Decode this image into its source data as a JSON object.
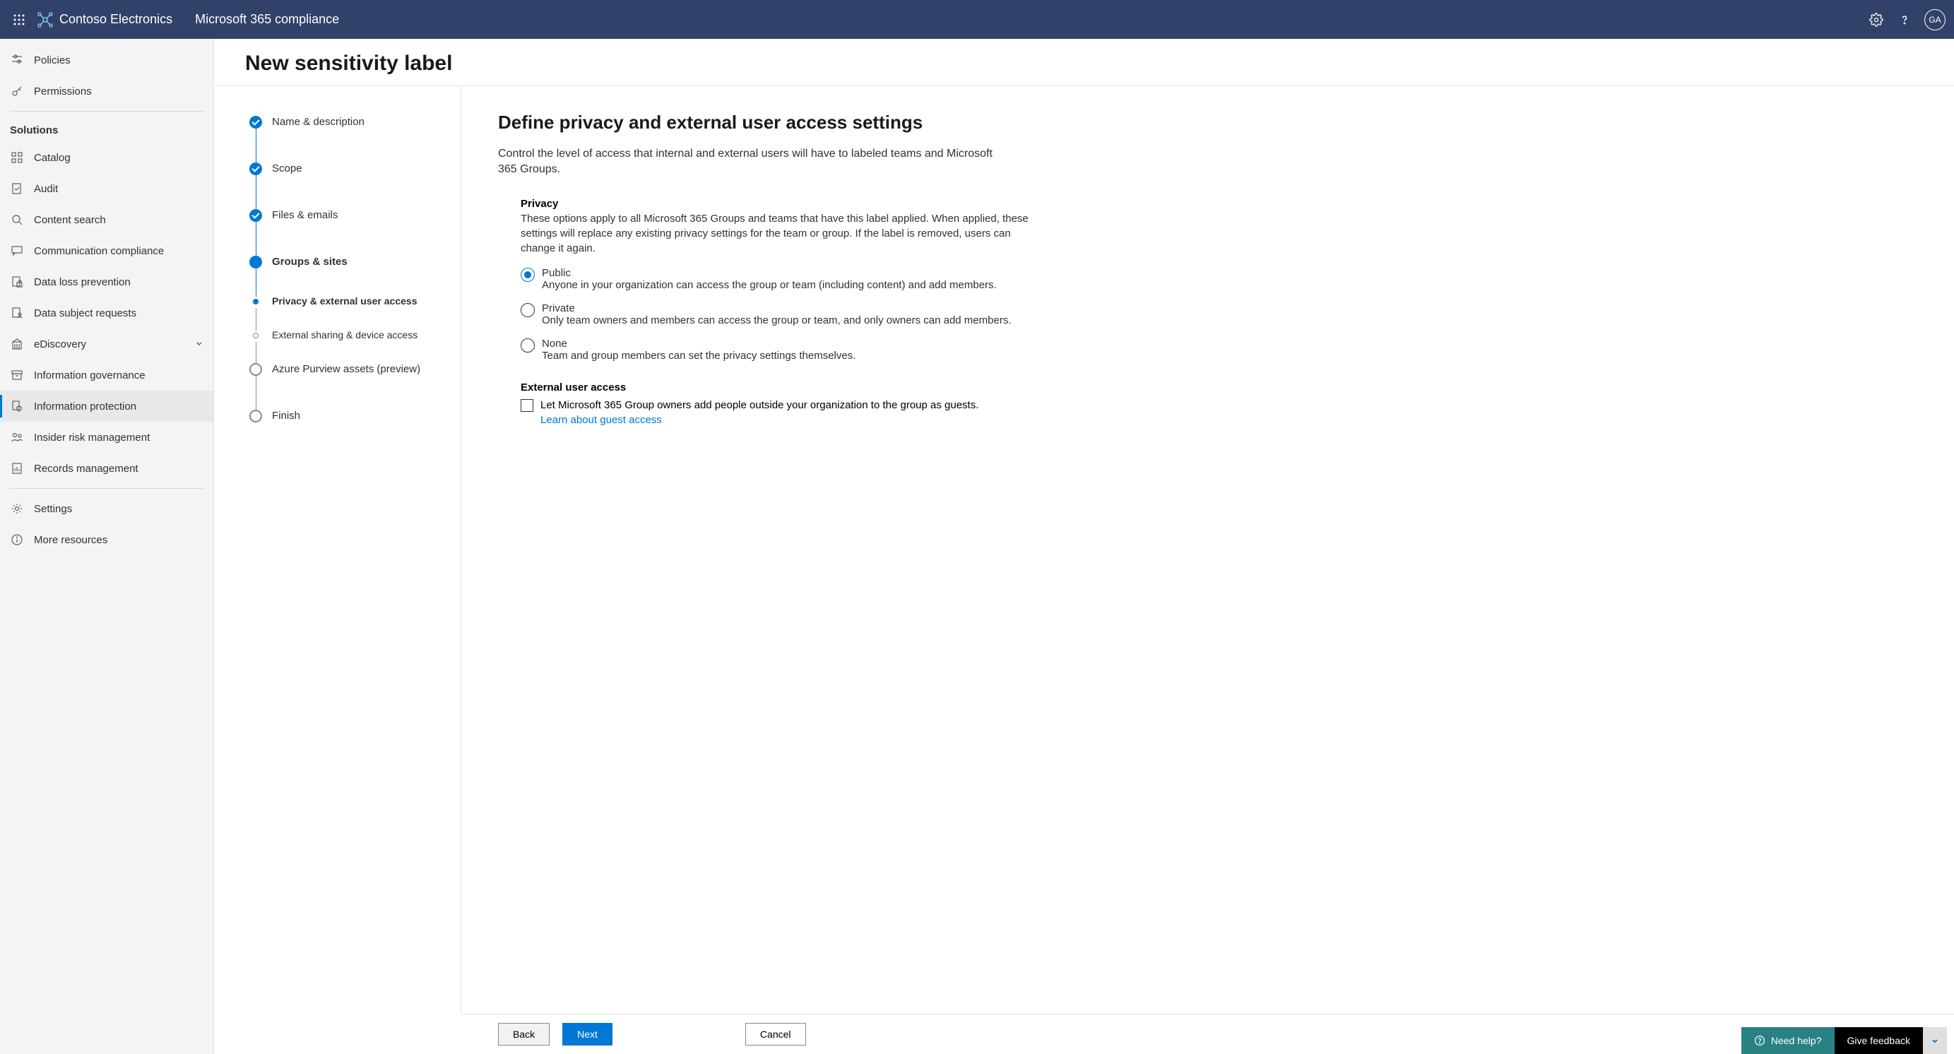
{
  "header": {
    "org_name": "Contoso Electronics",
    "app_title": "Microsoft 365 compliance",
    "avatar_initials": "GA"
  },
  "sidebar": {
    "top_items": [
      {
        "id": "policies",
        "label": "Policies"
      },
      {
        "id": "permissions",
        "label": "Permissions"
      }
    ],
    "section_label": "Solutions",
    "solutions": [
      {
        "id": "catalog",
        "label": "Catalog"
      },
      {
        "id": "audit",
        "label": "Audit"
      },
      {
        "id": "content-search",
        "label": "Content search"
      },
      {
        "id": "communication-compliance",
        "label": "Communication compliance"
      },
      {
        "id": "data-loss-prevention",
        "label": "Data loss prevention"
      },
      {
        "id": "data-subject-requests",
        "label": "Data subject requests"
      },
      {
        "id": "ediscovery",
        "label": "eDiscovery",
        "expandable": true
      },
      {
        "id": "information-governance",
        "label": "Information governance"
      },
      {
        "id": "information-protection",
        "label": "Information protection",
        "active": true
      },
      {
        "id": "insider-risk-management",
        "label": "Insider risk management"
      },
      {
        "id": "records-management",
        "label": "Records management"
      }
    ],
    "bottom_items": [
      {
        "id": "settings",
        "label": "Settings"
      },
      {
        "id": "more-resources",
        "label": "More resources"
      }
    ]
  },
  "page": {
    "title": "New sensitivity label"
  },
  "stepper": {
    "steps": [
      {
        "label": "Name & description",
        "state": "complete"
      },
      {
        "label": "Scope",
        "state": "complete"
      },
      {
        "label": "Files & emails",
        "state": "complete"
      },
      {
        "label": "Groups & sites",
        "state": "current",
        "sub": [
          {
            "label": "Privacy & external user access",
            "state": "current"
          },
          {
            "label": "External sharing & device access",
            "state": "future"
          }
        ]
      },
      {
        "label": "Azure Purview assets (preview)",
        "state": "future"
      },
      {
        "label": "Finish",
        "state": "future"
      }
    ]
  },
  "form": {
    "heading": "Define privacy and external user access settings",
    "intro": "Control the level of access that internal and external users will have to labeled teams and Microsoft 365 Groups.",
    "privacy": {
      "heading": "Privacy",
      "desc": "These options apply to all Microsoft 365 Groups and teams that have this label applied. When applied, these settings will replace any existing privacy settings for the team or group. If the label is removed, users can change it again.",
      "options": [
        {
          "title": "Public",
          "sub": "Anyone in your organization can access the group or team (including content) and add members.",
          "selected": true
        },
        {
          "title": "Private",
          "sub": "Only team owners and members can access the group or team, and only owners can add members.",
          "selected": false
        },
        {
          "title": "None",
          "sub": "Team and group members can set the privacy settings themselves.",
          "selected": false
        }
      ]
    },
    "external": {
      "heading": "External user access",
      "check_label": "Let Microsoft 365 Group owners add people outside your organization to the group as guests.",
      "link": "Learn about guest access"
    }
  },
  "footer": {
    "back": "Back",
    "next": "Next",
    "cancel": "Cancel"
  },
  "helper": {
    "need_help": "Need help?",
    "feedback": "Give feedback"
  }
}
